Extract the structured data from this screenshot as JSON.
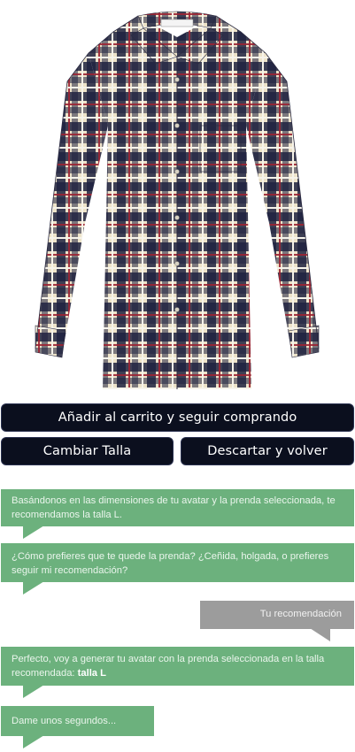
{
  "product": {
    "image_name": "plaid-shirt-image",
    "colors": {
      "navy": "#1f2240",
      "red": "#9b2433",
      "cream": "#ede3c9",
      "white": "#f6f3ea"
    }
  },
  "actions": {
    "add_to_cart_label": "Añadir al carrito y seguir comprando",
    "change_size_label": "Cambiar Talla",
    "discard_label": "Descartar y volver"
  },
  "chat": {
    "messages": [
      {
        "role": "bot",
        "text": "Basándonos en las dimensiones de tu avatar y la prenda seleccionada, te recomendamos la talla L."
      },
      {
        "role": "bot",
        "text": "¿Cómo prefieres que te quede la prenda? ¿Ceñida, holgada, o prefieres seguir mi recomendación?"
      },
      {
        "role": "user",
        "text": "Tu recomendación"
      },
      {
        "role": "bot",
        "text": "Perfecto, voy a generar tu avatar con la prenda seleccionada en la talla recomendada: ",
        "bold": "talla L"
      },
      {
        "role": "bot",
        "text": "Dame unos segundos..."
      }
    ],
    "colors": {
      "bot_bubble": "#6cb17d",
      "user_bubble": "#9c9c9c"
    }
  }
}
